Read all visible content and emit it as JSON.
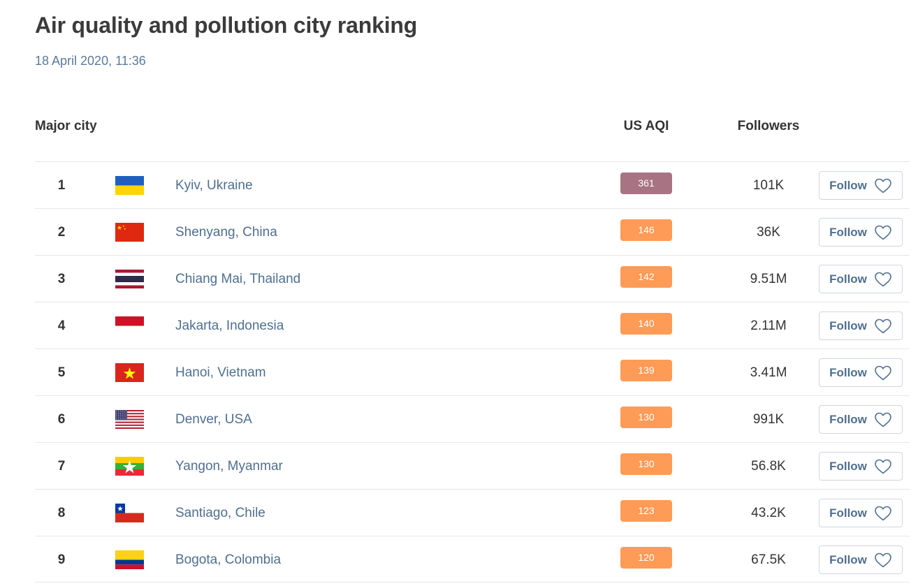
{
  "page": {
    "title": "Air quality and pollution city ranking",
    "timestamp": "18 April 2020, 11:36"
  },
  "table": {
    "headers": {
      "city": "Major city",
      "aqi": "US AQI",
      "followers": "Followers"
    },
    "follow_label": "Follow",
    "rows": [
      {
        "rank": "1",
        "city": "Kyiv, Ukraine",
        "aqi": "361",
        "followers": "101K",
        "flag": "ukraine",
        "aqi_color": "#a87383"
      },
      {
        "rank": "2",
        "city": "Shenyang, China",
        "aqi": "146",
        "followers": "36K",
        "flag": "china",
        "aqi_color": "#fe9b57"
      },
      {
        "rank": "3",
        "city": "Chiang Mai, Thailand",
        "aqi": "142",
        "followers": "9.51M",
        "flag": "thailand",
        "aqi_color": "#fe9b57"
      },
      {
        "rank": "4",
        "city": "Jakarta, Indonesia",
        "aqi": "140",
        "followers": "2.11M",
        "flag": "indonesia",
        "aqi_color": "#fe9b57"
      },
      {
        "rank": "5",
        "city": "Hanoi, Vietnam",
        "aqi": "139",
        "followers": "3.41M",
        "flag": "vietnam",
        "aqi_color": "#fe9b57"
      },
      {
        "rank": "6",
        "city": "Denver, USA",
        "aqi": "130",
        "followers": "991K",
        "flag": "usa",
        "aqi_color": "#fe9b57"
      },
      {
        "rank": "7",
        "city": "Yangon, Myanmar",
        "aqi": "130",
        "followers": "56.8K",
        "flag": "myanmar",
        "aqi_color": "#fe9b57"
      },
      {
        "rank": "8",
        "city": "Santiago, Chile",
        "aqi": "123",
        "followers": "43.2K",
        "flag": "chile",
        "aqi_color": "#fe9b57"
      },
      {
        "rank": "9",
        "city": "Bogota, Colombia",
        "aqi": "120",
        "followers": "67.5K",
        "flag": "colombia",
        "aqi_color": "#fe9b57"
      }
    ]
  }
}
